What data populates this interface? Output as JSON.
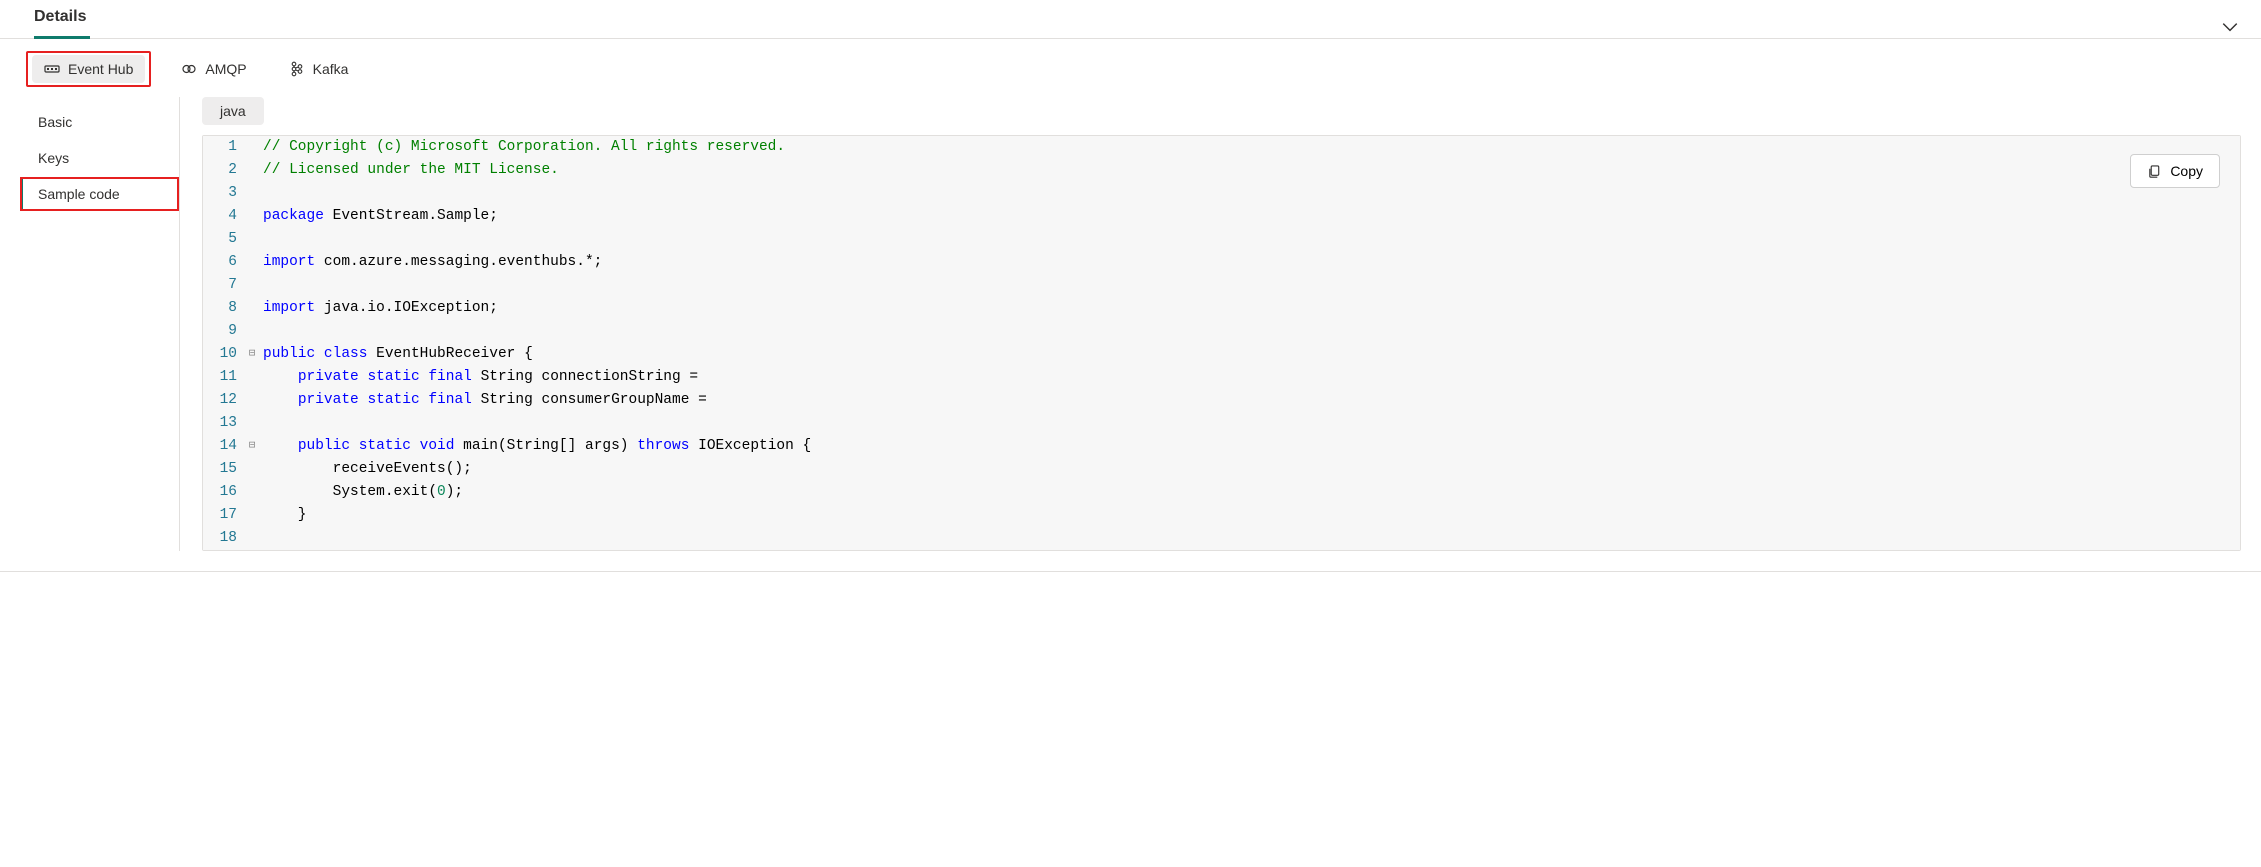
{
  "header": {
    "title": "Details"
  },
  "protocols": [
    {
      "id": "eventhub",
      "label": "Event Hub",
      "active": true,
      "highlighted": true
    },
    {
      "id": "amqp",
      "label": "AMQP",
      "active": false,
      "highlighted": false
    },
    {
      "id": "kafka",
      "label": "Kafka",
      "active": false,
      "highlighted": false
    }
  ],
  "sidenav": [
    {
      "id": "basic",
      "label": "Basic",
      "active": false,
      "highlighted": false
    },
    {
      "id": "keys",
      "label": "Keys",
      "active": false,
      "highlighted": false
    },
    {
      "id": "samplecode",
      "label": "Sample code",
      "active": true,
      "highlighted": true
    }
  ],
  "language_tab": "java",
  "copy_label": "Copy",
  "code": {
    "lines": [
      {
        "n": 1,
        "fold": "",
        "tokens": [
          [
            "c",
            "// Copyright (c) Microsoft Corporation. All rights reserved."
          ]
        ]
      },
      {
        "n": 2,
        "fold": "",
        "tokens": [
          [
            "c",
            "// Licensed under the MIT License."
          ]
        ]
      },
      {
        "n": 3,
        "fold": "",
        "tokens": []
      },
      {
        "n": 4,
        "fold": "",
        "tokens": [
          [
            "k",
            "package"
          ],
          [
            "t",
            " EventStream.Sample;"
          ]
        ]
      },
      {
        "n": 5,
        "fold": "",
        "tokens": []
      },
      {
        "n": 6,
        "fold": "",
        "tokens": [
          [
            "k",
            "import"
          ],
          [
            "t",
            " com.azure.messaging.eventhubs.*;"
          ]
        ]
      },
      {
        "n": 7,
        "fold": "",
        "tokens": []
      },
      {
        "n": 8,
        "fold": "",
        "tokens": [
          [
            "k",
            "import"
          ],
          [
            "t",
            " java.io.IOException;"
          ]
        ]
      },
      {
        "n": 9,
        "fold": "",
        "tokens": []
      },
      {
        "n": 10,
        "fold": "⊟",
        "tokens": [
          [
            "k",
            "public"
          ],
          [
            "t",
            " "
          ],
          [
            "k",
            "class"
          ],
          [
            "t",
            " EventHubReceiver {"
          ]
        ]
      },
      {
        "n": 11,
        "fold": "",
        "tokens": [
          [
            "t",
            "    "
          ],
          [
            "k",
            "private"
          ],
          [
            "t",
            " "
          ],
          [
            "k",
            "static"
          ],
          [
            "t",
            " "
          ],
          [
            "k",
            "final"
          ],
          [
            "t",
            " String connectionString ="
          ]
        ]
      },
      {
        "n": 12,
        "fold": "",
        "tokens": [
          [
            "t",
            "    "
          ],
          [
            "k",
            "private"
          ],
          [
            "t",
            " "
          ],
          [
            "k",
            "static"
          ],
          [
            "t",
            " "
          ],
          [
            "k",
            "final"
          ],
          [
            "t",
            " String consumerGroupName ="
          ]
        ]
      },
      {
        "n": 13,
        "fold": "",
        "tokens": []
      },
      {
        "n": 14,
        "fold": "⊟",
        "tokens": [
          [
            "t",
            "    "
          ],
          [
            "k",
            "public"
          ],
          [
            "t",
            " "
          ],
          [
            "k",
            "static"
          ],
          [
            "t",
            " "
          ],
          [
            "k",
            "void"
          ],
          [
            "t",
            " main(String[] args) "
          ],
          [
            "k",
            "throws"
          ],
          [
            "t",
            " IOException {"
          ]
        ]
      },
      {
        "n": 15,
        "fold": "",
        "tokens": [
          [
            "t",
            "        receiveEvents();"
          ]
        ]
      },
      {
        "n": 16,
        "fold": "",
        "tokens": [
          [
            "t",
            "        System.exit("
          ],
          [
            "n",
            "0"
          ],
          [
            "t",
            ");"
          ]
        ]
      },
      {
        "n": 17,
        "fold": "",
        "tokens": [
          [
            "t",
            "    }"
          ]
        ]
      },
      {
        "n": 18,
        "fold": "",
        "tokens": []
      }
    ]
  }
}
